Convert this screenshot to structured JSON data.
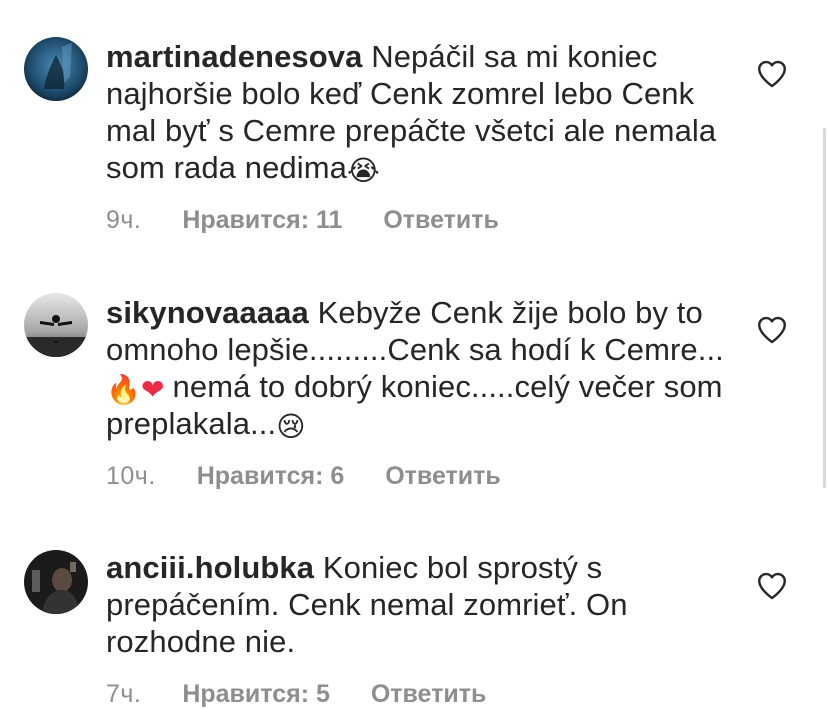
{
  "comments": [
    {
      "username": "martinadenesova",
      "text": "Nepáčil sa mi koniec najhoršie bolo keď Cenk zomrel lebo Cenk mal byť s Cemre prepáčte všetci ale nemala som rada nedima",
      "emoji_1": "😭",
      "time": "9ч.",
      "likes": "Нравится: 11",
      "reply": "Ответить",
      "avatar_icon": "profile-photo-icon",
      "like_icon": "heart-outline-icon"
    },
    {
      "username": "sikynovaaaaa",
      "text_part1": "Kebyže Cenk žije bolo by to omnoho lepšie.........Cenk sa hodí k Cemre...",
      "emoji_1": "🔥",
      "emoji_2": "❤",
      "text_part2": "nemá to dobrý koniec.....celý večer som preplakala...",
      "emoji_3": "😢",
      "time": "10ч.",
      "likes": "Нравится: 6",
      "reply": "Ответить",
      "avatar_icon": "profile-photo-icon",
      "like_icon": "heart-outline-icon"
    },
    {
      "username": "anciii.holubka",
      "text": "Koniec bol sprostý s prepáčením. Cenk nemal zomrieť. On rozhodne nie.",
      "time": "7ч.",
      "likes": "Нравится: 5",
      "reply": "Ответить",
      "avatar_icon": "profile-photo-icon",
      "like_icon": "heart-outline-icon"
    }
  ],
  "colors": {
    "text": "#262626",
    "meta": "#8e8e8e",
    "icon": "#262626",
    "emoji_fire": "#ff7a00",
    "emoji_heart": "#ed2b45",
    "emoji_face": "#f5c33b",
    "emoji_tear": "#5ab4e8"
  }
}
